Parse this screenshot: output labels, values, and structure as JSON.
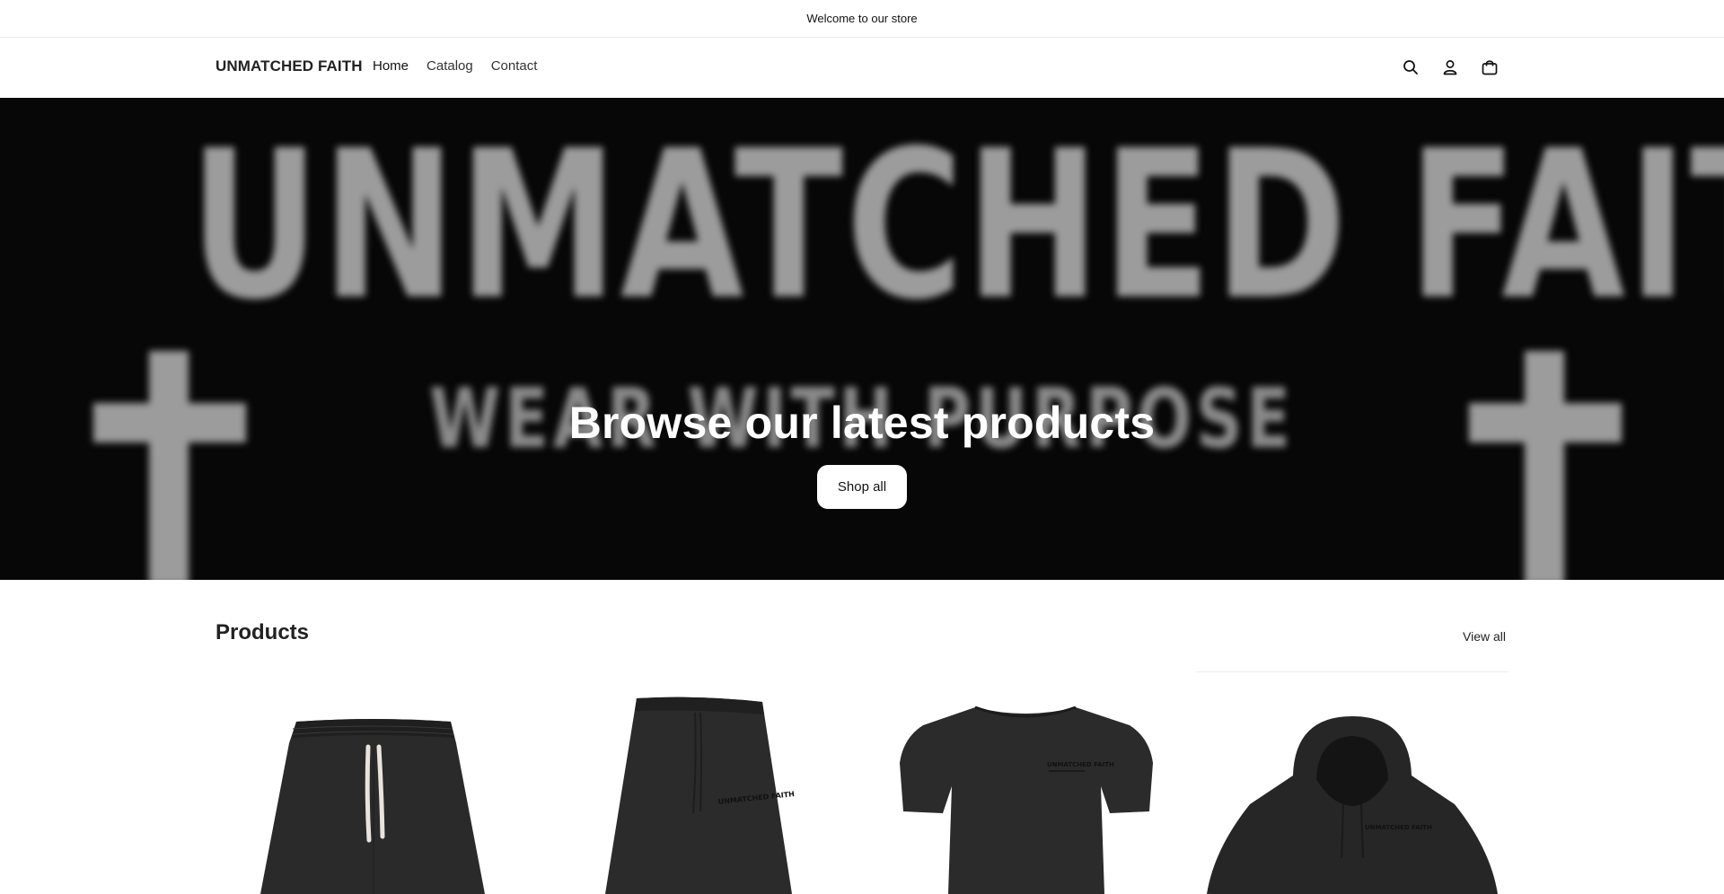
{
  "announcement": {
    "text": "Welcome to our store"
  },
  "header": {
    "logo": "UNMATCHED FAITH",
    "nav": [
      {
        "label": "Home"
      },
      {
        "label": "Catalog"
      },
      {
        "label": "Contact"
      }
    ],
    "icons": [
      "search-icon",
      "account-icon",
      "cart-icon"
    ]
  },
  "hero": {
    "background_brand": "UNMATCHED FAITH",
    "background_tagline": "WEAR WITH PURPOSE",
    "title": "Browse our latest products",
    "button_label": "Shop all"
  },
  "products": {
    "title": "Products",
    "view_all": "View all",
    "items": [
      {
        "image": "black-shorts-with-drawstrings"
      },
      {
        "image": "black-long-shorts-side-view"
      },
      {
        "image": "black-tshirt"
      },
      {
        "image": "black-hoodie"
      }
    ],
    "print_text": "UNMATCHED FAITH"
  },
  "colors": {
    "hero_bg": "#070707",
    "text": "#121212",
    "garment": "#2a2a2a"
  }
}
